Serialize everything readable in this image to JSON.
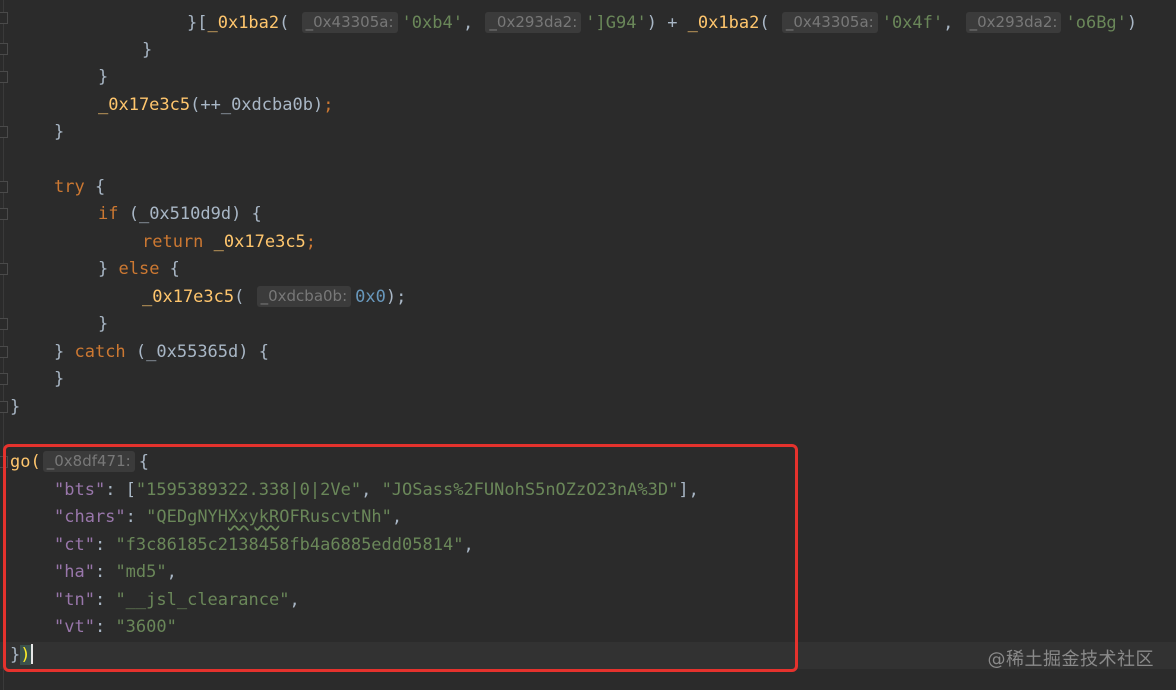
{
  "code": {
    "line_0": {
      "fn_a": "_0x1ba2",
      "hint_a": "_0x43305a:",
      "str_a": "'0xb4'",
      "hint_b": "_0x293da2:",
      "str_b": "']G94'",
      "fn_b": "_0x1ba2",
      "hint_c": "_0x43305a:",
      "str_c": "'0x4f'",
      "hint_d": "_0x293da2:",
      "str_d": "'o6Bg'"
    },
    "line_1": {
      "text": "}"
    },
    "line_2": {
      "text": "}"
    },
    "line_3": {
      "fn": "_0x17e3c5",
      "arg": "(++_0xdcba0b)",
      "semi": ";"
    },
    "line_4": {
      "text": "}"
    },
    "line_5": {
      "kw": "try",
      "rest": " {"
    },
    "line_6": {
      "kw": "if",
      "rest": " (_0x510d9d) {"
    },
    "line_7": {
      "kw": "return",
      "fn": "_0x17e3c5",
      "semi": ";"
    },
    "line_8": {
      "pre": "} ",
      "kw": "else",
      "rest": " {"
    },
    "line_9": {
      "fn": "_0x17e3c5",
      "hint": "_0xdcba0b:",
      "num": "0x0",
      "tail": ");"
    },
    "line_10": {
      "text": "}"
    },
    "line_11": {
      "pre": "} ",
      "kw": "catch",
      "rest": " (_0x55365d) {"
    },
    "line_12": {
      "text": "}"
    },
    "line_13": {
      "text": "}"
    },
    "go_line": {
      "fn": "go",
      "hint": "_0x8df471:",
      "brace": "{"
    },
    "bts_line": {
      "key": "\"bts\"",
      "v1": "\"1595389322.338|0|2Ve\"",
      "v2": "\"JOSass%2FUNohS5nOZzO23nA%3D\""
    },
    "chars_line": {
      "key": "\"chars\"",
      "pre": "\"QEDgNYH",
      "squiggle": "XxykR",
      "post": "OFRuscvtNh\""
    },
    "ct_line": {
      "key": "\"ct\"",
      "value": "\"f3c86185c2138458fb4a6885edd05814\""
    },
    "ha_line": {
      "key": "\"ha\"",
      "value": "\"md5\""
    },
    "tn_line": {
      "key": "\"tn\"",
      "value": "\"__jsl_clearance\""
    },
    "vt_line": {
      "key": "\"vt\"",
      "value": "\"3600\""
    },
    "end_line": {
      "brace": "}",
      "paren": ")"
    }
  },
  "watermark": "@稀土掘金技术社区",
  "colors": {
    "background": "#2b2b2b",
    "keyword": "#cc7832",
    "function": "#ffc66d",
    "string": "#6a8759",
    "number": "#6897bb",
    "json_key": "#9876aa",
    "highlight_box": "#e5322d"
  }
}
